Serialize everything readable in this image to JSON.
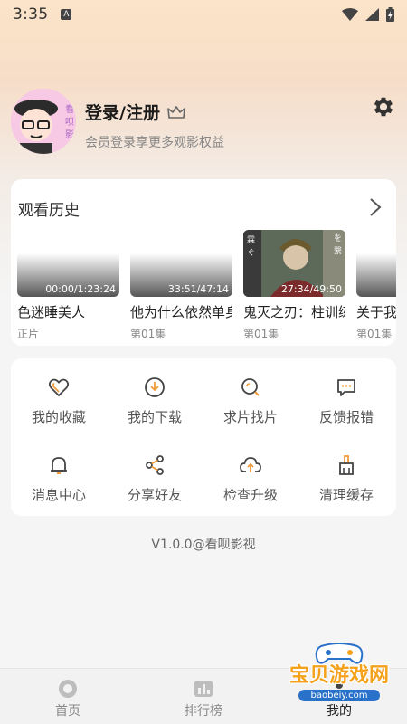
{
  "status_bar": {
    "time": "3:35",
    "a_icon": "A"
  },
  "profile": {
    "title": "登录/注册",
    "subtitle": "会员登录享更多观影权益",
    "avatar_text": "看呗影视"
  },
  "history": {
    "title": "观看历史",
    "items": [
      {
        "time": "00:00/1:23:24",
        "title": "色迷睡美人",
        "sub": "正片"
      },
      {
        "time": "33:51/47:14",
        "title": "他为什么依然单身",
        "sub": "第01集"
      },
      {
        "time": "27:34/49:50",
        "title": "鬼灭之刃：柱训练篇",
        "sub": "第01集"
      },
      {
        "time": "",
        "title": "关于我",
        "sub": "第01集"
      }
    ]
  },
  "functions": [
    {
      "label": "我的收藏",
      "icon": "heart-icon"
    },
    {
      "label": "我的下载",
      "icon": "download-icon"
    },
    {
      "label": "求片找片",
      "icon": "search-movie-icon"
    },
    {
      "label": "反馈报错",
      "icon": "feedback-icon"
    },
    {
      "label": "消息中心",
      "icon": "bell-icon"
    },
    {
      "label": "分享好友",
      "icon": "share-icon"
    },
    {
      "label": "检查升级",
      "icon": "upgrade-icon"
    },
    {
      "label": "清理缓存",
      "icon": "broom-icon"
    }
  ],
  "version": "V1.0.0@看呗影视",
  "tabs": [
    {
      "label": "首页",
      "icon": "home-icon"
    },
    {
      "label": "排行榜",
      "icon": "ranking-icon"
    },
    {
      "label": "我的",
      "icon": "profile-icon"
    }
  ],
  "watermark": {
    "text": "宝贝游戏网",
    "url": "baobeiy.com"
  },
  "colors": {
    "accent": "#f4a21c",
    "icon_orange": "#f29b3a"
  }
}
